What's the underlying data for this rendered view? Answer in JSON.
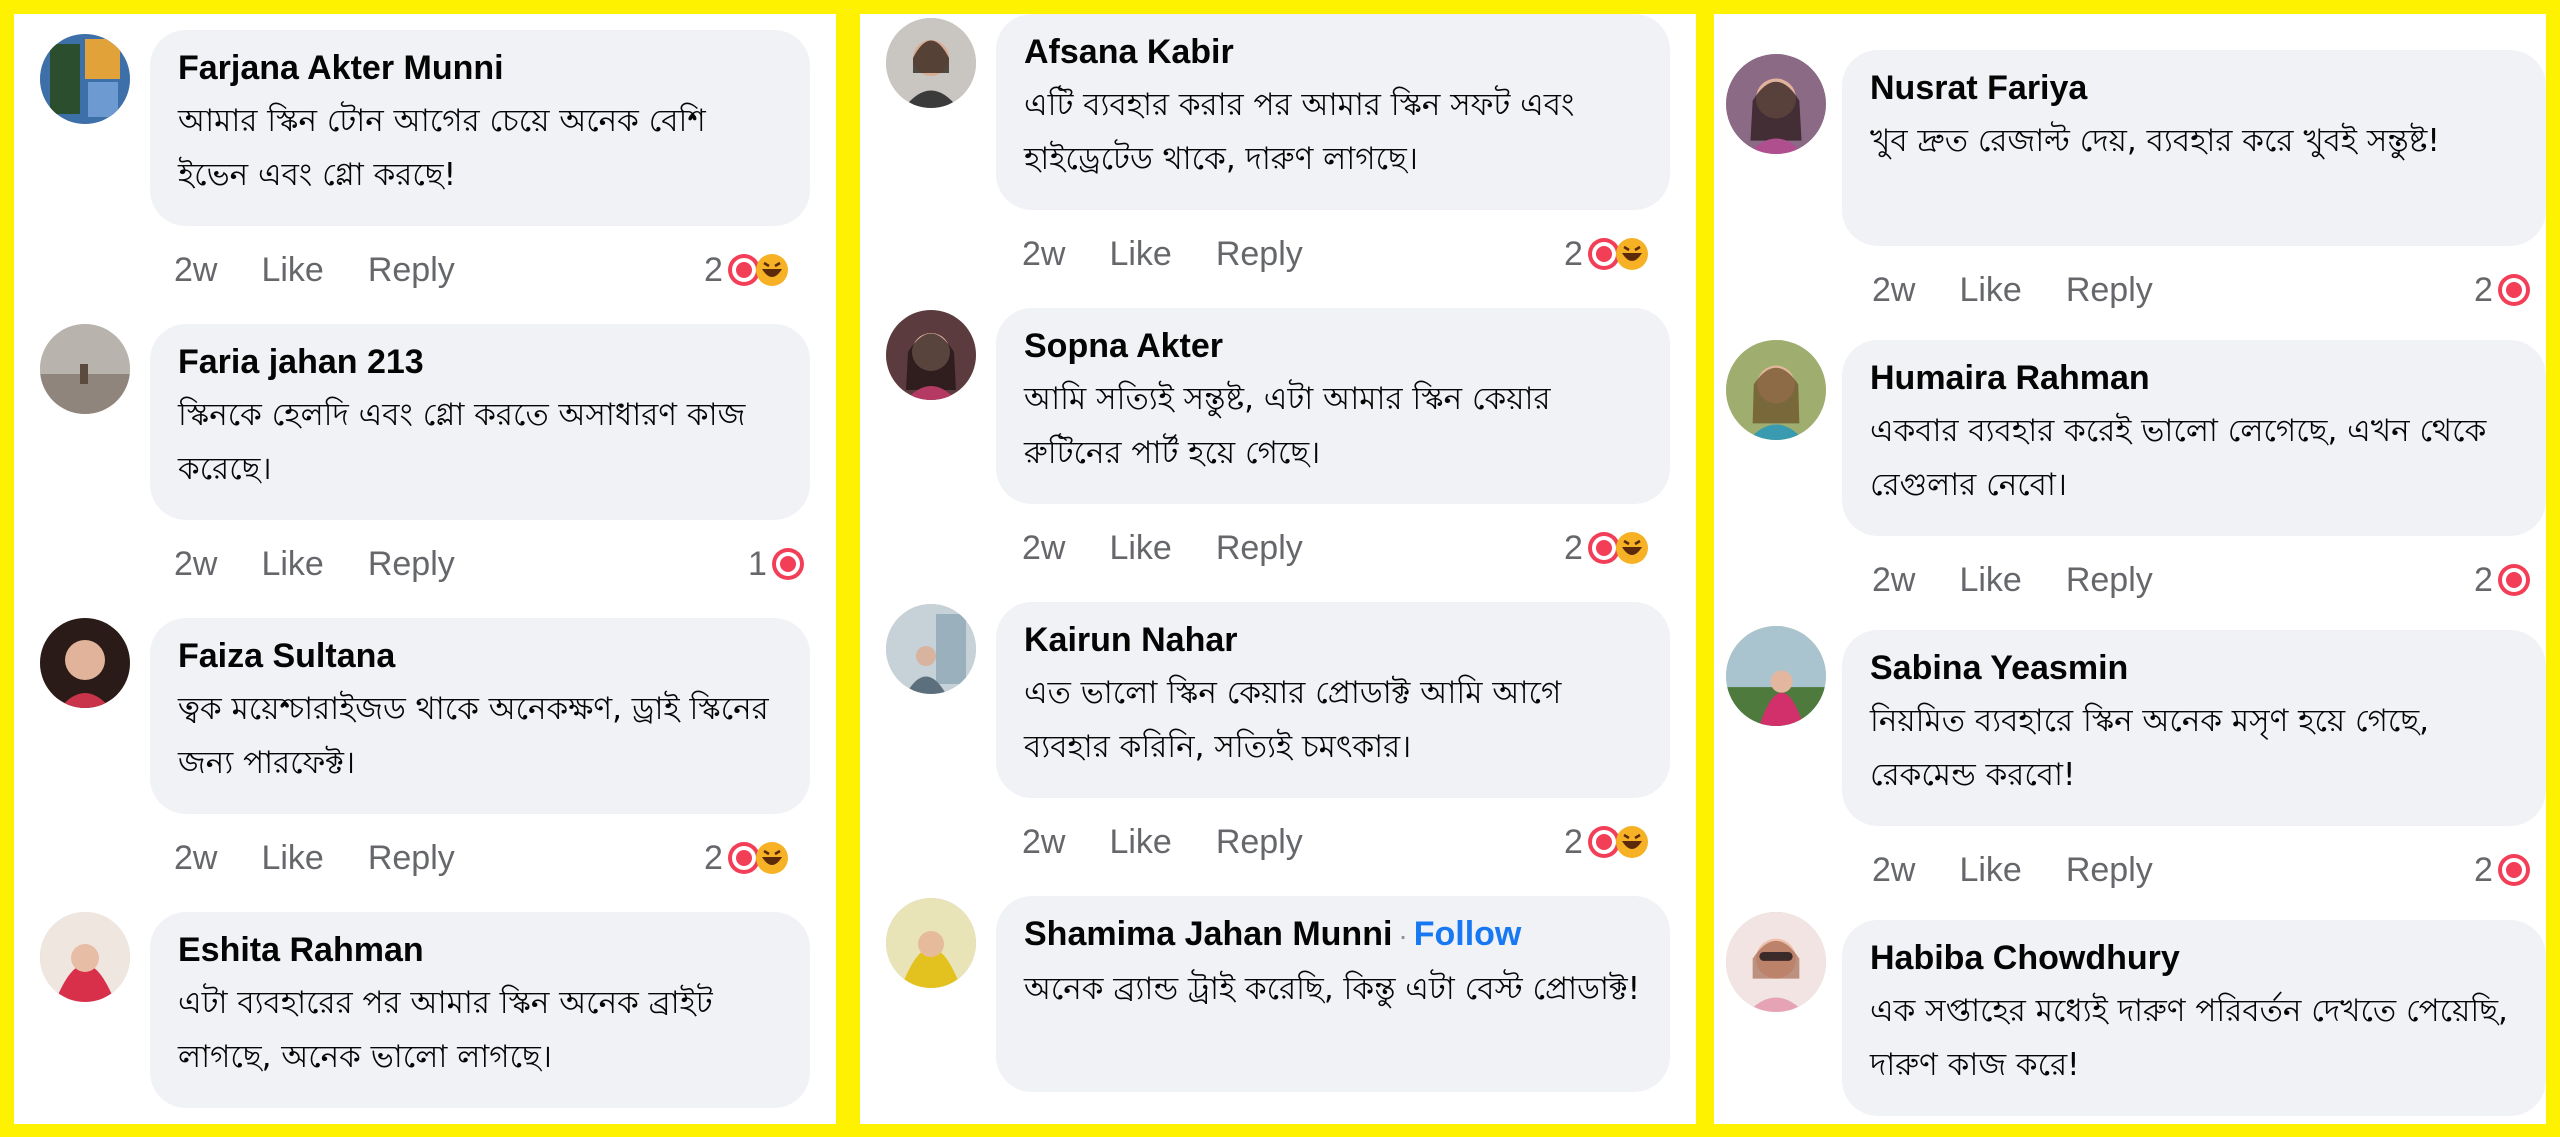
{
  "colors": {
    "frame": "#FFF200",
    "bubble": "#F0F2F5",
    "meta_text": "#65676B",
    "follow": "#1877F2",
    "love": "#F33E58",
    "haha": "#F7B125"
  },
  "panels": [
    {
      "comments": [
        {
          "name": "Farjana Akter Munni",
          "text": "আমার স্কিন টোন আগের চেয়ে অনেক বেশি ইভেন এবং গ্লো করছে!",
          "time": "2w",
          "like": "Like",
          "reply": "Reply",
          "count": "2",
          "reactions": [
            "love-icon",
            "haha-icon"
          ]
        },
        {
          "name": "Faria jahan 213",
          "text": "স্কিনকে হেলদি এবং গ্লো করতে অসাধারণ কাজ করেছে।",
          "time": "2w",
          "like": "Like",
          "reply": "Reply",
          "count": "1",
          "reactions": [
            "love-icon"
          ]
        },
        {
          "name": "Faiza Sultana",
          "text": "ত্বক ময়েশ্চারাইজড থাকে অনেকক্ষণ, ড্রাই স্কিনের জন্য পারফেক্ট।",
          "time": "2w",
          "like": "Like",
          "reply": "Reply",
          "count": "2",
          "reactions": [
            "love-icon",
            "haha-icon"
          ]
        },
        {
          "name": "Eshita Rahman",
          "text": "এটা ব্যবহারের পর আমার স্কিন অনেক ব্রাইট লাগছে, অনেক ভালো লাগছে।"
        }
      ]
    },
    {
      "comments": [
        {
          "name": "Afsana Kabir",
          "text": "এটি ব্যবহার করার পর আমার স্কিন সফট এবং হাইড্রেটেড থাকে, দারুণ লাগছে।",
          "time": "2w",
          "like": "Like",
          "reply": "Reply",
          "count": "2",
          "reactions": [
            "love-icon",
            "haha-icon"
          ]
        },
        {
          "name": "Sopna Akter",
          "text": "আমি সত্যিই সন্তুষ্ট, এটা আমার স্কিন কেয়ার রুটিনের পার্ট হয়ে গেছে।",
          "time": "2w",
          "like": "Like",
          "reply": "Reply",
          "count": "2",
          "reactions": [
            "love-icon",
            "haha-icon"
          ]
        },
        {
          "name": "Kairun Nahar",
          "text": "এত ভালো স্কিন কেয়ার প্রোডাক্ট আমি আগে ব্যবহার করিনি, সত্যিই চমৎকার।",
          "time": "2w",
          "like": "Like",
          "reply": "Reply",
          "count": "2",
          "reactions": [
            "love-icon",
            "haha-icon"
          ]
        },
        {
          "name": "Shamima Jahan Munni",
          "follow_sep": "·",
          "follow": "Follow",
          "text": "অনেক ব্র্যান্ড ট্রাই করেছি, কিন্তু এটা বেস্ট প্রোডাক্ট!"
        }
      ]
    },
    {
      "comments": [
        {
          "name": "Nusrat Fariya",
          "text": "খুব দ্রুত রেজাল্ট দেয়, ব্যবহার করে খুবই সন্তুষ্ট!",
          "time": "2w",
          "like": "Like",
          "reply": "Reply",
          "count": "2",
          "reactions": [
            "love-icon"
          ]
        },
        {
          "name": "Humaira Rahman",
          "text": "একবার ব্যবহার করেই ভালো লেগেছে, এখন থেকে রেগুলার নেবো।",
          "time": "2w",
          "like": "Like",
          "reply": "Reply",
          "count": "2",
          "reactions": [
            "love-icon"
          ]
        },
        {
          "name": "Sabina Yeasmin",
          "text": "নিয়মিত ব্যবহারে স্কিন অনেক মসৃণ হয়ে গেছে, রেকমেন্ড করবো!",
          "time": "2w",
          "like": "Like",
          "reply": "Reply",
          "count": "2",
          "reactions": [
            "love-icon"
          ]
        },
        {
          "name": "Habiba Chowdhury",
          "text": "এক সপ্তাহের মধ্যেই দারুণ পরিবর্তন দেখতে পেয়েছি, দারুণ কাজ করে!"
        }
      ]
    }
  ]
}
